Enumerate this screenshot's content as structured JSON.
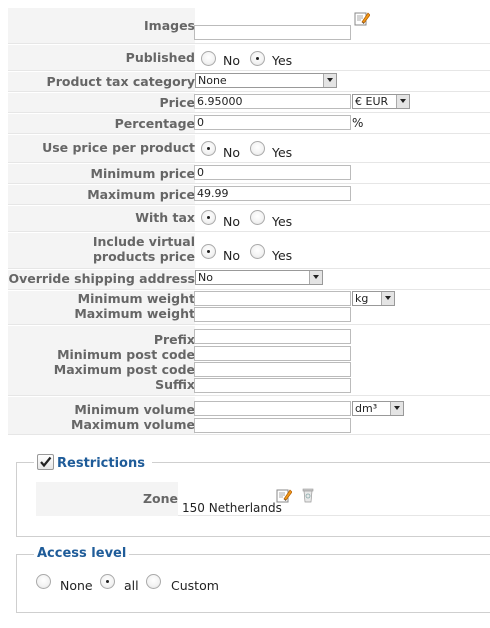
{
  "fields": {
    "images": {
      "label": "Images",
      "value": ""
    },
    "published": {
      "label": "Published",
      "options": [
        "No",
        "Yes"
      ],
      "selected": "Yes"
    },
    "product_tax_category": {
      "label": "Product tax category",
      "selected": "None"
    },
    "price": {
      "label": "Price",
      "value": "6.95000",
      "currency": "€ EUR"
    },
    "percentage": {
      "label": "Percentage",
      "value": "0",
      "unit": "%"
    },
    "use_price_per_product": {
      "label": "Use price per product",
      "options": [
        "No",
        "Yes"
      ],
      "selected": "No"
    },
    "minimum_price": {
      "label": "Minimum price",
      "value": "0"
    },
    "maximum_price": {
      "label": "Maximum price",
      "value": "49.99"
    },
    "with_tax": {
      "label": "With tax",
      "options": [
        "No",
        "Yes"
      ],
      "selected": "No"
    },
    "include_virtual": {
      "label_line1": "Include virtual",
      "label_line2": "products price",
      "options": [
        "No",
        "Yes"
      ],
      "selected": "No"
    },
    "override_shipping": {
      "label": "Override shipping address",
      "selected": "No"
    },
    "minimum_weight": {
      "label": "Minimum weight",
      "value": "",
      "unit": "kg"
    },
    "maximum_weight": {
      "label": "Maximum weight",
      "value": ""
    },
    "prefix": {
      "label": "Prefix",
      "value": ""
    },
    "minimum_post_code": {
      "label": "Minimum post code",
      "value": ""
    },
    "maximum_post_code": {
      "label": "Maximum post code",
      "value": ""
    },
    "suffix": {
      "label": "Suffix",
      "value": ""
    },
    "minimum_volume": {
      "label": "Minimum volume",
      "value": "",
      "unit": "dm³"
    },
    "maximum_volume": {
      "label": "Maximum volume",
      "value": ""
    }
  },
  "restrictions": {
    "legend": "Restrictions",
    "checked": true,
    "zone_label": "Zone",
    "zone_value": "150 Netherlands"
  },
  "access_level": {
    "legend": "Access level",
    "options": [
      "None",
      "all",
      "Custom"
    ],
    "selected": "all"
  },
  "colors": {
    "legend": "#1f5c99",
    "label_bg": "#f4f4f4",
    "label_text": "#666666"
  }
}
